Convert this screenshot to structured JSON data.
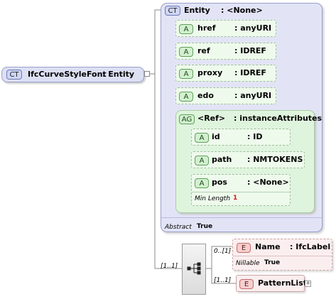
{
  "root": {
    "badge": "CT",
    "name": "IfcCurveStyleFont",
    "type": ": Entity"
  },
  "entity": {
    "badge": "CT",
    "name": "Entity",
    "type": ": <None>",
    "attributes": [
      {
        "badge": "A",
        "name": "href",
        "type": ": anyURI"
      },
      {
        "badge": "A",
        "name": "ref",
        "type": ": IDREF"
      },
      {
        "badge": "A",
        "name": "proxy",
        "type": ": IDREF"
      },
      {
        "badge": "A",
        "name": "edo",
        "type": ": anyURI"
      }
    ],
    "group": {
      "badge": "AG",
      "name": "<Ref>",
      "type": ": instanceAttributes",
      "attributes": [
        {
          "badge": "A",
          "name": "id",
          "type": ": ID"
        },
        {
          "badge": "A",
          "name": "path",
          "type": ": NMTOKENS"
        },
        {
          "badge": "A",
          "name": "pos",
          "type": ": <None>",
          "facet_label": "Min Length",
          "facet_value": "1"
        }
      ]
    },
    "abstract_label": "Abstract",
    "abstract_value": "True"
  },
  "sequence": {
    "multiplicity": "[1..1]",
    "icon": "sequence-icon"
  },
  "elements": [
    {
      "badge": "E",
      "name": "Name",
      "type": ": IfcLabel",
      "multiplicity": "0..[1]",
      "nillable_label": "Nillable",
      "nillable_value": "True"
    },
    {
      "badge": "E",
      "name": "PatternList",
      "multiplicity": "[1..1]",
      "expand": "+"
    }
  ],
  "colors": {
    "entity_panel": "#e2e4f6",
    "entity_border": "#9aa1cf",
    "group_panel": "#dff4dd",
    "attribute_fill": "#eefaec",
    "element_fill": "#fbeeee",
    "element_border": "#c9a6a6"
  }
}
